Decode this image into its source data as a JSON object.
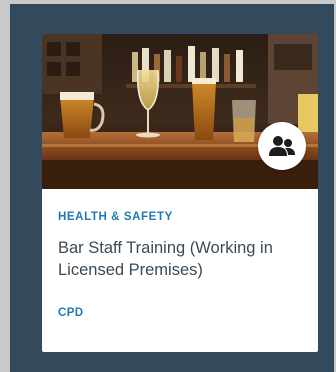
{
  "card": {
    "category": "HEALTH & SAFETY",
    "title": "Bar Staff Training (Working in Licensed Premises)",
    "tag": "CPD",
    "image_alt": "bar-scene-image",
    "badge_icon": "group-icon"
  },
  "colors": {
    "page_background": "#334a5c",
    "accent": "#1f78b4",
    "title_text": "#3b4a56",
    "card_background": "#ffffff"
  }
}
